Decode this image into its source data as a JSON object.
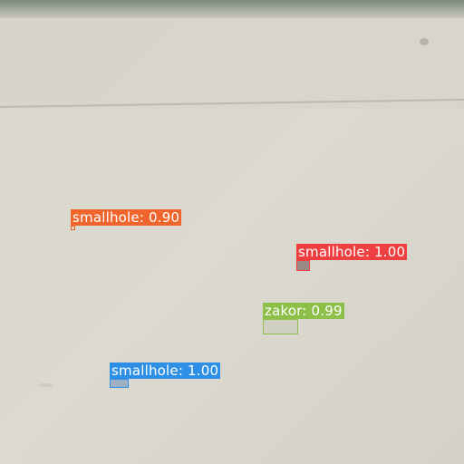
{
  "detections": [
    {
      "label": "smallhole: 0.90",
      "color": "#f0652c"
    },
    {
      "label": "smallhole: 1.00",
      "color": "#ee4040"
    },
    {
      "label": "zakor: 0.99",
      "color": "#8cc048"
    },
    {
      "label": "smallhole: 1.00",
      "color": "#2e8fe6"
    }
  ]
}
